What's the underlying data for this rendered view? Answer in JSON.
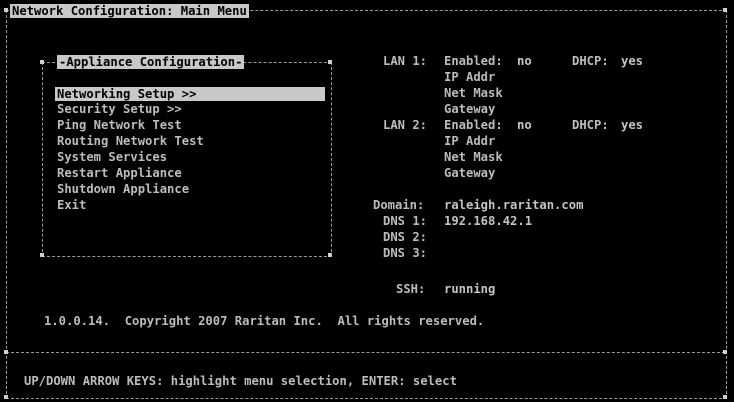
{
  "colors": {
    "background": "#000000",
    "text": "#bcbcbc",
    "highlight_bg": "#c8c8c8",
    "highlight_fg": "#000000",
    "border": "#9a9a9a"
  },
  "window": {
    "title": "Network Configuration: Main Menu"
  },
  "menu": {
    "title": "-Appliance Configuration-",
    "items": [
      {
        "label": "Networking Setup >>",
        "selected": true
      },
      {
        "label": "Security Setup >>",
        "selected": false
      },
      {
        "label": "Ping Network Test",
        "selected": false
      },
      {
        "label": "Routing Network Test",
        "selected": false
      },
      {
        "label": "System Services",
        "selected": false
      },
      {
        "label": "Restart Appliance",
        "selected": false
      },
      {
        "label": "Shutdown Appliance",
        "selected": false
      },
      {
        "label": "Exit",
        "selected": false
      }
    ]
  },
  "status": {
    "lan1": {
      "label": "LAN 1:",
      "enabled_label": "Enabled:",
      "enabled": "no",
      "dhcp_label": "DHCP:",
      "dhcp": "yes",
      "ip_label": "IP Addr",
      "mask_label": "Net Mask",
      "gateway_label": "Gateway"
    },
    "lan2": {
      "label": "LAN 2:",
      "enabled_label": "Enabled:",
      "enabled": "no",
      "dhcp_label": "DHCP:",
      "dhcp": "yes",
      "ip_label": "IP Addr",
      "mask_label": "Net Mask",
      "gateway_label": "Gateway"
    },
    "domain_label": "Domain:",
    "domain": "raleigh.raritan.com",
    "dns1_label": "DNS 1:",
    "dns1": "192.168.42.1",
    "dns2_label": "DNS 2:",
    "dns2": "",
    "dns3_label": "DNS 3:",
    "dns3": "",
    "ssh_label": "SSH:",
    "ssh": "running"
  },
  "copyright": "1.0.0.14.  Copyright 2007 Raritan Inc.  All rights reserved.",
  "help": "UP/DOWN ARROW KEYS: highlight menu selection, ENTER: select"
}
